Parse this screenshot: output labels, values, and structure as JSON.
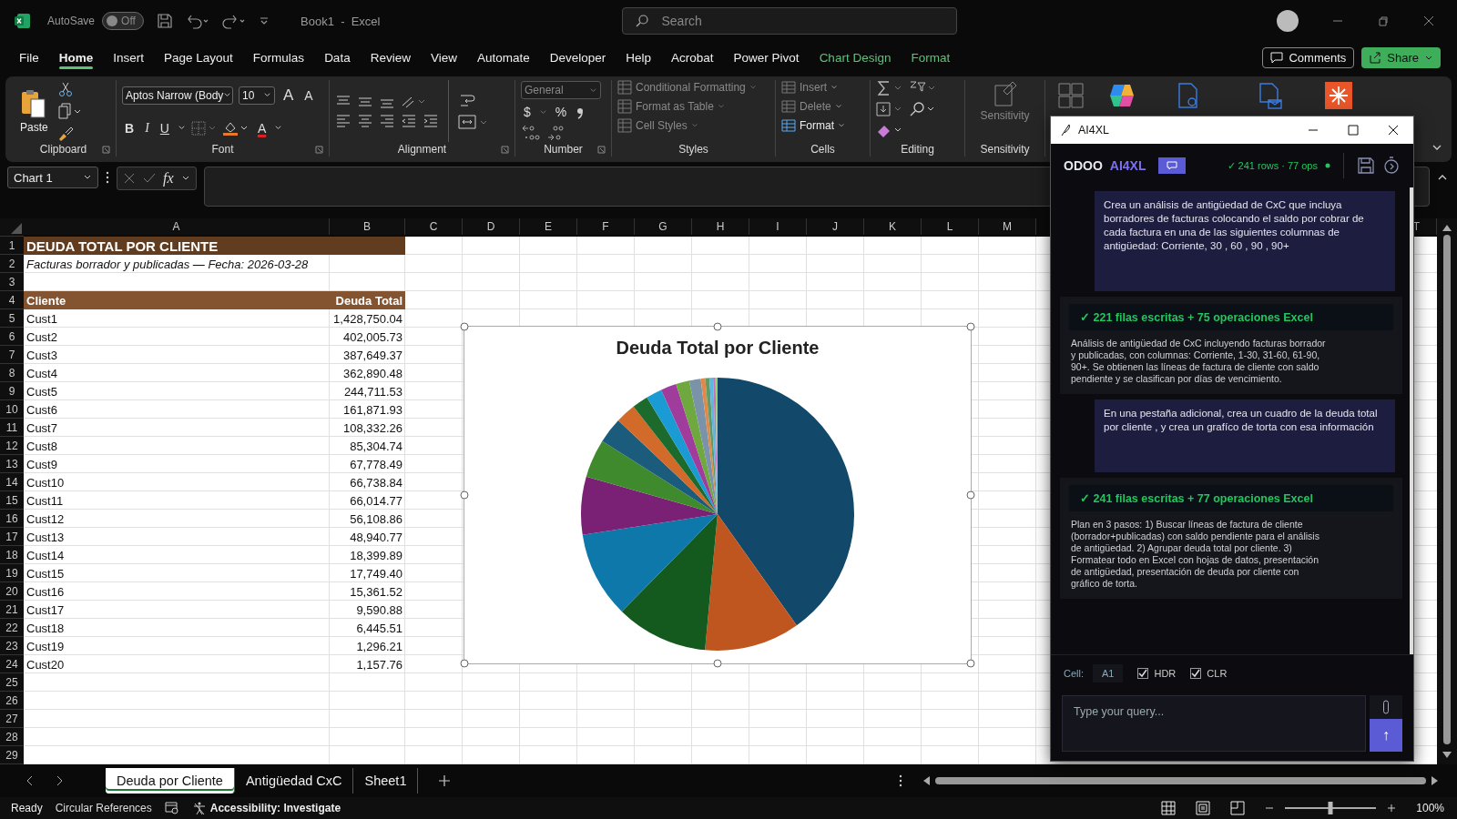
{
  "titlebar": {
    "autosave_label": "AutoSave",
    "autosave_state": "Off",
    "autosave_on": false,
    "doc_title": "Book1  -  Excel",
    "search_placeholder": "Search"
  },
  "menu_tabs": [
    {
      "label": "File",
      "selected": false,
      "kind": "normal"
    },
    {
      "label": "Home",
      "selected": true,
      "kind": "normal"
    },
    {
      "label": "Insert",
      "selected": false,
      "kind": "normal"
    },
    {
      "label": "Page Layout",
      "selected": false,
      "kind": "normal"
    },
    {
      "label": "Formulas",
      "selected": false,
      "kind": "normal"
    },
    {
      "label": "Data",
      "selected": false,
      "kind": "normal"
    },
    {
      "label": "Review",
      "selected": false,
      "kind": "normal"
    },
    {
      "label": "View",
      "selected": false,
      "kind": "normal"
    },
    {
      "label": "Automate",
      "selected": false,
      "kind": "normal"
    },
    {
      "label": "Developer",
      "selected": false,
      "kind": "normal"
    },
    {
      "label": "Help",
      "selected": false,
      "kind": "normal"
    },
    {
      "label": "Acrobat",
      "selected": false,
      "kind": "normal"
    },
    {
      "label": "Power Pivot",
      "selected": false,
      "kind": "normal"
    },
    {
      "label": "Chart Design",
      "selected": false,
      "kind": "contextual"
    },
    {
      "label": "Format",
      "selected": false,
      "kind": "contextual"
    }
  ],
  "comments_label": "Comments",
  "share_label": "Share",
  "ribbon": {
    "clipboard": {
      "paste": "Paste",
      "group": "Clipboard"
    },
    "font": {
      "family": "Aptos Narrow (Body",
      "size": "10",
      "grow": "A",
      "shrink": "A",
      "bold": "B",
      "italic": "I",
      "underline": "U",
      "font_color": "A",
      "group": "Font"
    },
    "alignment_group": "Alignment",
    "number": {
      "format": "General",
      "currency": "$",
      "percent": "%",
      "group": "Number"
    },
    "styles": {
      "items": [
        {
          "label": "Conditional Formatting",
          "disabled": true
        },
        {
          "label": "Format as Table",
          "disabled": true
        },
        {
          "label": "Cell Styles",
          "disabled": true
        }
      ],
      "group": "Styles"
    },
    "cells": {
      "items": [
        {
          "label": "Insert",
          "disabled": true
        },
        {
          "label": "Delete",
          "disabled": true
        },
        {
          "label": "Format",
          "disabled": false
        }
      ],
      "group": "Cells"
    },
    "editing_group": "Editing",
    "sensitivity": {
      "label": "Sensitivity",
      "group": "Sensitivity"
    }
  },
  "formula_bar": {
    "name_box": "Chart 1",
    "fx": "fx"
  },
  "columns": [
    "A",
    "B",
    "C",
    "D",
    "E",
    "F",
    "G",
    "H",
    "I",
    "J",
    "K",
    "L",
    "M"
  ],
  "columns_right": [
    "T"
  ],
  "row_numbers": [
    "1",
    "2",
    "3",
    "4",
    "5",
    "6",
    "7",
    "8",
    "9",
    "10",
    "11",
    "12",
    "13",
    "14",
    "15",
    "16",
    "17",
    "18",
    "19",
    "20",
    "21",
    "22",
    "23",
    "24",
    "25",
    "26",
    "27",
    "28",
    "29"
  ],
  "table": {
    "title": "DEUDA TOTAL POR CLIENTE",
    "subtitle": "Facturas borrador y publicadas — Fecha: 2026-03-28",
    "headers": [
      "Cliente",
      "Deuda Total"
    ],
    "rows": [
      [
        "Cust1",
        "1,428,750.04"
      ],
      [
        "Cust2",
        "402,005.73"
      ],
      [
        "Cust3",
        "387,649.37"
      ],
      [
        "Cust4",
        "362,890.48"
      ],
      [
        "Cust5",
        "244,711.53"
      ],
      [
        "Cust6",
        "161,871.93"
      ],
      [
        "Cust7",
        "108,332.26"
      ],
      [
        "Cust8",
        "85,304.74"
      ],
      [
        "Cust9",
        "67,778.49"
      ],
      [
        "Cust10",
        "66,738.84"
      ],
      [
        "Cust11",
        "66,014.77"
      ],
      [
        "Cust12",
        "56,108.86"
      ],
      [
        "Cust13",
        "48,940.77"
      ],
      [
        "Cust14",
        "18,399.89"
      ],
      [
        "Cust15",
        "17,749.40"
      ],
      [
        "Cust16",
        "15,361.52"
      ],
      [
        "Cust17",
        "9,590.88"
      ],
      [
        "Cust18",
        "6,445.51"
      ],
      [
        "Cust19",
        "1,296.21"
      ],
      [
        "Cust20",
        "1,157.76"
      ]
    ]
  },
  "chart": {
    "title": "Deuda Total por Cliente"
  },
  "sheet_tabs": [
    {
      "label": "Deuda por Cliente",
      "selected": true
    },
    {
      "label": "Antigüedad CxC",
      "selected": false
    },
    {
      "label": "Sheet1",
      "selected": false
    }
  ],
  "status_bar": {
    "ready": "Ready",
    "circular": "Circular References",
    "accessibility": "Accessibility: Investigate",
    "zoom": "100%",
    "zoom_slider": {
      "level": 0.5
    }
  },
  "panel": {
    "title": "AI4XL",
    "brand": "ODOO",
    "brand2": "AI4XL",
    "status": "✓ 241 rows · 77 ops",
    "messages": [
      {
        "kind": "user",
        "text": "Crea un análisis de antigüedad de CxC que incluya borradores de facturas colocando el saldo por cobrar de cada factura en una de las siguientes columnas de antigüedad: Corriente, 30 , 60 , 90 , 90+"
      },
      {
        "kind": "result",
        "headline": "✓  221 filas escritas  +  75 operaciones Excel",
        "text": "Análisis de antigüedad de CxC incluyendo facturas borrador y publicadas, con columnas: Corriente, 1-30, 31-60, 61-90, 90+. Se obtienen las líneas de factura de cliente con saldo pendiente y se clasifican por días de vencimiento."
      },
      {
        "kind": "user",
        "text": "En una pestaña adicional, crea un cuadro de la deuda total por cliente , y crea un grafíco de torta con esa información"
      },
      {
        "kind": "result",
        "headline": "✓  241 filas escritas  +  77 operaciones Excel",
        "text": "Plan en 3 pasos: 1) Buscar líneas de factura de cliente (borrador+publicadas) con saldo pendiente para el análisis de antigüedad. 2) Agrupar deuda total por cliente. 3) Formatear todo en Excel con hojas de datos, presentación de antigüedad, presentación de deuda por cliente con gráfico de torta."
      }
    ],
    "cell_label": "Cell:",
    "cell_value": "A1",
    "options": [
      {
        "label": "HDR",
        "checked": true
      },
      {
        "label": "CLR",
        "checked": true
      }
    ],
    "placeholder": "Type your query...",
    "send": "↑"
  }
}
